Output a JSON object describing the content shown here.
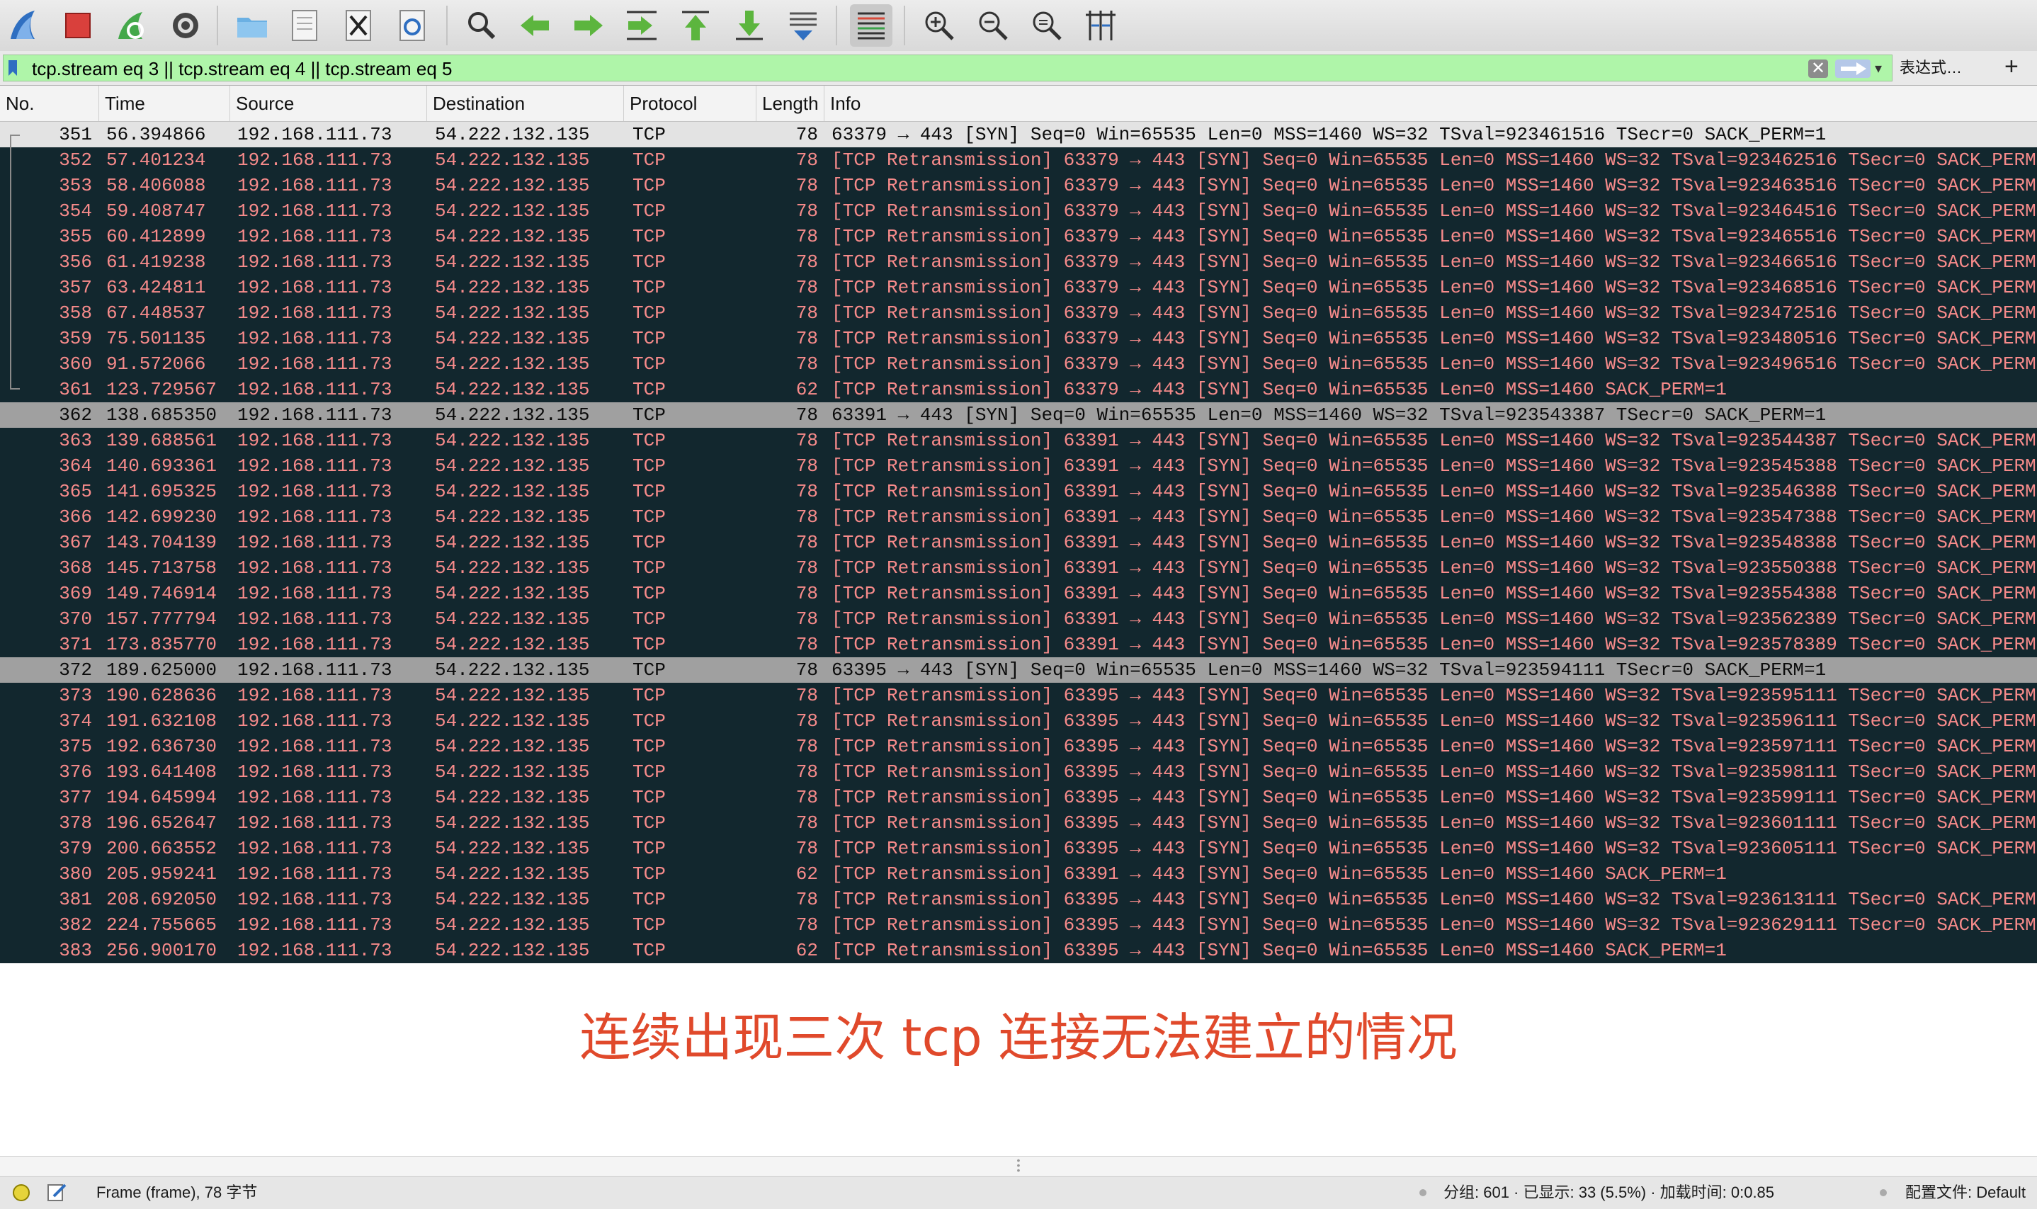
{
  "toolbar": {
    "buttons": [
      {
        "name": "start-capture-icon"
      },
      {
        "name": "stop-capture-icon"
      },
      {
        "name": "restart-capture-icon"
      },
      {
        "name": "capture-options-icon"
      },
      {
        "name": "open-file-icon"
      },
      {
        "name": "save-file-icon"
      },
      {
        "name": "close-file-icon"
      },
      {
        "name": "reload-file-icon"
      },
      {
        "name": "find-packet-icon"
      },
      {
        "name": "go-back-icon"
      },
      {
        "name": "go-forward-icon"
      },
      {
        "name": "go-to-packet-icon"
      },
      {
        "name": "first-packet-icon"
      },
      {
        "name": "last-packet-icon"
      },
      {
        "name": "autoscroll-icon"
      },
      {
        "name": "colorize-icon"
      },
      {
        "name": "zoom-in-icon"
      },
      {
        "name": "zoom-out-icon"
      },
      {
        "name": "zoom-normal-icon"
      },
      {
        "name": "resize-columns-icon"
      }
    ]
  },
  "filter": {
    "value": "tcp.stream eq 3 || tcp.stream eq 4 || tcp.stream eq 5",
    "clear_glyph": "✕",
    "expression_label": "表达式…",
    "add_label": "+"
  },
  "columns": {
    "no": "No.",
    "time": "Time",
    "source": "Source",
    "destination": "Destination",
    "protocol": "Protocol",
    "length": "Length",
    "info": "Info"
  },
  "packets": [
    {
      "no": "351",
      "time": "56.394866",
      "src": "192.168.111.73",
      "dst": "54.222.132.135",
      "proto": "TCP",
      "len": "78",
      "info": "63379 → 443 [SYN] Seq=0 Win=65535 Len=0 MSS=1460 WS=32 TSval=923461516 TSecr=0 SACK_PERM=1",
      "kind": "first"
    },
    {
      "no": "352",
      "time": "57.401234",
      "src": "192.168.111.73",
      "dst": "54.222.132.135",
      "proto": "TCP",
      "len": "78",
      "info": "[TCP Retransmission] 63379 → 443 [SYN] Seq=0 Win=65535 Len=0 MSS=1460 WS=32 TSval=923462516 TSecr=0 SACK_PERM",
      "kind": "retrans"
    },
    {
      "no": "353",
      "time": "58.406088",
      "src": "192.168.111.73",
      "dst": "54.222.132.135",
      "proto": "TCP",
      "len": "78",
      "info": "[TCP Retransmission] 63379 → 443 [SYN] Seq=0 Win=65535 Len=0 MSS=1460 WS=32 TSval=923463516 TSecr=0 SACK_PERM",
      "kind": "retrans"
    },
    {
      "no": "354",
      "time": "59.408747",
      "src": "192.168.111.73",
      "dst": "54.222.132.135",
      "proto": "TCP",
      "len": "78",
      "info": "[TCP Retransmission] 63379 → 443 [SYN] Seq=0 Win=65535 Len=0 MSS=1460 WS=32 TSval=923464516 TSecr=0 SACK_PERM",
      "kind": "retrans"
    },
    {
      "no": "355",
      "time": "60.412899",
      "src": "192.168.111.73",
      "dst": "54.222.132.135",
      "proto": "TCP",
      "len": "78",
      "info": "[TCP Retransmission] 63379 → 443 [SYN] Seq=0 Win=65535 Len=0 MSS=1460 WS=32 TSval=923465516 TSecr=0 SACK_PERM",
      "kind": "retrans"
    },
    {
      "no": "356",
      "time": "61.419238",
      "src": "192.168.111.73",
      "dst": "54.222.132.135",
      "proto": "TCP",
      "len": "78",
      "info": "[TCP Retransmission] 63379 → 443 [SYN] Seq=0 Win=65535 Len=0 MSS=1460 WS=32 TSval=923466516 TSecr=0 SACK_PERM",
      "kind": "retrans"
    },
    {
      "no": "357",
      "time": "63.424811",
      "src": "192.168.111.73",
      "dst": "54.222.132.135",
      "proto": "TCP",
      "len": "78",
      "info": "[TCP Retransmission] 63379 → 443 [SYN] Seq=0 Win=65535 Len=0 MSS=1460 WS=32 TSval=923468516 TSecr=0 SACK_PERM",
      "kind": "retrans"
    },
    {
      "no": "358",
      "time": "67.448537",
      "src": "192.168.111.73",
      "dst": "54.222.132.135",
      "proto": "TCP",
      "len": "78",
      "info": "[TCP Retransmission] 63379 → 443 [SYN] Seq=0 Win=65535 Len=0 MSS=1460 WS=32 TSval=923472516 TSecr=0 SACK_PERM",
      "kind": "retrans"
    },
    {
      "no": "359",
      "time": "75.501135",
      "src": "192.168.111.73",
      "dst": "54.222.132.135",
      "proto": "TCP",
      "len": "78",
      "info": "[TCP Retransmission] 63379 → 443 [SYN] Seq=0 Win=65535 Len=0 MSS=1460 WS=32 TSval=923480516 TSecr=0 SACK_PERM",
      "kind": "retrans"
    },
    {
      "no": "360",
      "time": "91.572066",
      "src": "192.168.111.73",
      "dst": "54.222.132.135",
      "proto": "TCP",
      "len": "78",
      "info": "[TCP Retransmission] 63379 → 443 [SYN] Seq=0 Win=65535 Len=0 MSS=1460 WS=32 TSval=923496516 TSecr=0 SACK_PERM",
      "kind": "retrans"
    },
    {
      "no": "361",
      "time": "123.729567",
      "src": "192.168.111.73",
      "dst": "54.222.132.135",
      "proto": "TCP",
      "len": "62",
      "info": "[TCP Retransmission] 63379 → 443 [SYN] Seq=0 Win=65535 Len=0 MSS=1460 SACK_PERM=1",
      "kind": "retrans"
    },
    {
      "no": "362",
      "time": "138.685350",
      "src": "192.168.111.73",
      "dst": "54.222.132.135",
      "proto": "TCP",
      "len": "78",
      "info": "63391 → 443 [SYN] Seq=0 Win=65535 Len=0 MSS=1460 WS=32 TSval=923543387 TSecr=0 SACK_PERM=1",
      "kind": "syn"
    },
    {
      "no": "363",
      "time": "139.688561",
      "src": "192.168.111.73",
      "dst": "54.222.132.135",
      "proto": "TCP",
      "len": "78",
      "info": "[TCP Retransmission] 63391 → 443 [SYN] Seq=0 Win=65535 Len=0 MSS=1460 WS=32 TSval=923544387 TSecr=0 SACK_PERM",
      "kind": "retrans"
    },
    {
      "no": "364",
      "time": "140.693361",
      "src": "192.168.111.73",
      "dst": "54.222.132.135",
      "proto": "TCP",
      "len": "78",
      "info": "[TCP Retransmission] 63391 → 443 [SYN] Seq=0 Win=65535 Len=0 MSS=1460 WS=32 TSval=923545388 TSecr=0 SACK_PERM",
      "kind": "retrans"
    },
    {
      "no": "365",
      "time": "141.695325",
      "src": "192.168.111.73",
      "dst": "54.222.132.135",
      "proto": "TCP",
      "len": "78",
      "info": "[TCP Retransmission] 63391 → 443 [SYN] Seq=0 Win=65535 Len=0 MSS=1460 WS=32 TSval=923546388 TSecr=0 SACK_PERM",
      "kind": "retrans"
    },
    {
      "no": "366",
      "time": "142.699230",
      "src": "192.168.111.73",
      "dst": "54.222.132.135",
      "proto": "TCP",
      "len": "78",
      "info": "[TCP Retransmission] 63391 → 443 [SYN] Seq=0 Win=65535 Len=0 MSS=1460 WS=32 TSval=923547388 TSecr=0 SACK_PERM",
      "kind": "retrans"
    },
    {
      "no": "367",
      "time": "143.704139",
      "src": "192.168.111.73",
      "dst": "54.222.132.135",
      "proto": "TCP",
      "len": "78",
      "info": "[TCP Retransmission] 63391 → 443 [SYN] Seq=0 Win=65535 Len=0 MSS=1460 WS=32 TSval=923548388 TSecr=0 SACK_PERM",
      "kind": "retrans"
    },
    {
      "no": "368",
      "time": "145.713758",
      "src": "192.168.111.73",
      "dst": "54.222.132.135",
      "proto": "TCP",
      "len": "78",
      "info": "[TCP Retransmission] 63391 → 443 [SYN] Seq=0 Win=65535 Len=0 MSS=1460 WS=32 TSval=923550388 TSecr=0 SACK_PERM",
      "kind": "retrans"
    },
    {
      "no": "369",
      "time": "149.746914",
      "src": "192.168.111.73",
      "dst": "54.222.132.135",
      "proto": "TCP",
      "len": "78",
      "info": "[TCP Retransmission] 63391 → 443 [SYN] Seq=0 Win=65535 Len=0 MSS=1460 WS=32 TSval=923554388 TSecr=0 SACK_PERM",
      "kind": "retrans"
    },
    {
      "no": "370",
      "time": "157.777794",
      "src": "192.168.111.73",
      "dst": "54.222.132.135",
      "proto": "TCP",
      "len": "78",
      "info": "[TCP Retransmission] 63391 → 443 [SYN] Seq=0 Win=65535 Len=0 MSS=1460 WS=32 TSval=923562389 TSecr=0 SACK_PERM",
      "kind": "retrans"
    },
    {
      "no": "371",
      "time": "173.835770",
      "src": "192.168.111.73",
      "dst": "54.222.132.135",
      "proto": "TCP",
      "len": "78",
      "info": "[TCP Retransmission] 63391 → 443 [SYN] Seq=0 Win=65535 Len=0 MSS=1460 WS=32 TSval=923578389 TSecr=0 SACK_PERM",
      "kind": "retrans"
    },
    {
      "no": "372",
      "time": "189.625000",
      "src": "192.168.111.73",
      "dst": "54.222.132.135",
      "proto": "TCP",
      "len": "78",
      "info": "63395 → 443 [SYN] Seq=0 Win=65535 Len=0 MSS=1460 WS=32 TSval=923594111 TSecr=0 SACK_PERM=1",
      "kind": "syn"
    },
    {
      "no": "373",
      "time": "190.628636",
      "src": "192.168.111.73",
      "dst": "54.222.132.135",
      "proto": "TCP",
      "len": "78",
      "info": "[TCP Retransmission] 63395 → 443 [SYN] Seq=0 Win=65535 Len=0 MSS=1460 WS=32 TSval=923595111 TSecr=0 SACK_PERM",
      "kind": "retrans"
    },
    {
      "no": "374",
      "time": "191.632108",
      "src": "192.168.111.73",
      "dst": "54.222.132.135",
      "proto": "TCP",
      "len": "78",
      "info": "[TCP Retransmission] 63395 → 443 [SYN] Seq=0 Win=65535 Len=0 MSS=1460 WS=32 TSval=923596111 TSecr=0 SACK_PERM",
      "kind": "retrans"
    },
    {
      "no": "375",
      "time": "192.636730",
      "src": "192.168.111.73",
      "dst": "54.222.132.135",
      "proto": "TCP",
      "len": "78",
      "info": "[TCP Retransmission] 63395 → 443 [SYN] Seq=0 Win=65535 Len=0 MSS=1460 WS=32 TSval=923597111 TSecr=0 SACK_PERM",
      "kind": "retrans"
    },
    {
      "no": "376",
      "time": "193.641408",
      "src": "192.168.111.73",
      "dst": "54.222.132.135",
      "proto": "TCP",
      "len": "78",
      "info": "[TCP Retransmission] 63395 → 443 [SYN] Seq=0 Win=65535 Len=0 MSS=1460 WS=32 TSval=923598111 TSecr=0 SACK_PERM",
      "kind": "retrans"
    },
    {
      "no": "377",
      "time": "194.645994",
      "src": "192.168.111.73",
      "dst": "54.222.132.135",
      "proto": "TCP",
      "len": "78",
      "info": "[TCP Retransmission] 63395 → 443 [SYN] Seq=0 Win=65535 Len=0 MSS=1460 WS=32 TSval=923599111 TSecr=0 SACK_PERM",
      "kind": "retrans"
    },
    {
      "no": "378",
      "time": "196.652647",
      "src": "192.168.111.73",
      "dst": "54.222.132.135",
      "proto": "TCP",
      "len": "78",
      "info": "[TCP Retransmission] 63395 → 443 [SYN] Seq=0 Win=65535 Len=0 MSS=1460 WS=32 TSval=923601111 TSecr=0 SACK_PERM",
      "kind": "retrans"
    },
    {
      "no": "379",
      "time": "200.663552",
      "src": "192.168.111.73",
      "dst": "54.222.132.135",
      "proto": "TCP",
      "len": "78",
      "info": "[TCP Retransmission] 63395 → 443 [SYN] Seq=0 Win=65535 Len=0 MSS=1460 WS=32 TSval=923605111 TSecr=0 SACK_PERM",
      "kind": "retrans"
    },
    {
      "no": "380",
      "time": "205.959241",
      "src": "192.168.111.73",
      "dst": "54.222.132.135",
      "proto": "TCP",
      "len": "62",
      "info": "[TCP Retransmission] 63391 → 443 [SYN] Seq=0 Win=65535 Len=0 MSS=1460 SACK_PERM=1",
      "kind": "retrans"
    },
    {
      "no": "381",
      "time": "208.692050",
      "src": "192.168.111.73",
      "dst": "54.222.132.135",
      "proto": "TCP",
      "len": "78",
      "info": "[TCP Retransmission] 63395 → 443 [SYN] Seq=0 Win=65535 Len=0 MSS=1460 WS=32 TSval=923613111 TSecr=0 SACK_PERM",
      "kind": "retrans"
    },
    {
      "no": "382",
      "time": "224.755665",
      "src": "192.168.111.73",
      "dst": "54.222.132.135",
      "proto": "TCP",
      "len": "78",
      "info": "[TCP Retransmission] 63395 → 443 [SYN] Seq=0 Win=65535 Len=0 MSS=1460 WS=32 TSval=923629111 TSecr=0 SACK_PERM",
      "kind": "retrans"
    },
    {
      "no": "383",
      "time": "256.900170",
      "src": "192.168.111.73",
      "dst": "54.222.132.135",
      "proto": "TCP",
      "len": "62",
      "info": "[TCP Retransmission] 63395 → 443 [SYN] Seq=0 Win=65535 Len=0 MSS=1460 SACK_PERM=1",
      "kind": "retrans"
    }
  ],
  "caption": "连续出现三次 tcp 连接无法建立的情况",
  "status": {
    "frame": "Frame (frame), 78 字节",
    "packets": "分组: 601 · 已显示: 33 (5.5%) · 加载时间: 0:0.85",
    "profile": "配置文件: Default"
  },
  "colors": {
    "retrans_bg": "#12272e",
    "retrans_fg": "#f78b8b",
    "syn_bg": "#a0a0a0",
    "filter_valid_bg": "#aff5a9",
    "caption": "#e0492b"
  }
}
